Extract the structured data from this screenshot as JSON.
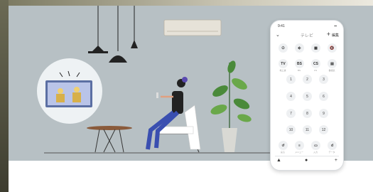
{
  "phone": {
    "status_time": "9:41",
    "status_right": "▪▪",
    "header_back": "⌄",
    "header_title": "テレビ",
    "header_add": "+",
    "header_edit": "編集",
    "row1": [
      {
        "icon": "power-icon",
        "glyph": "⏻",
        "label": ""
      },
      {
        "icon": "input-icon",
        "glyph": "⎆",
        "label": ""
      },
      {
        "icon": "grid-icon",
        "glyph": "▦",
        "label": ""
      },
      {
        "icon": "volume-mute-icon",
        "glyph": "🔇",
        "label": ""
      }
    ],
    "row2": [
      {
        "text": "TV",
        "label": "地上波"
      },
      {
        "text": "BS",
        "label": "BS"
      },
      {
        "text": "CS",
        "label": "CS"
      },
      {
        "text": "▤",
        "label": "番組表"
      }
    ],
    "numbers": [
      "1",
      "2",
      "3",
      "4",
      "5",
      "6",
      "7",
      "8",
      "9",
      "10",
      "11",
      "12"
    ],
    "row_bottom": [
      {
        "glyph": "↺",
        "label": "戻る"
      },
      {
        "glyph": "≡",
        "label": "メニュー"
      },
      {
        "glyph": "▭",
        "label": "入力"
      },
      {
        "glyph": "d",
        "label": "データ"
      }
    ],
    "bottom_bar": {
      "left": "▲",
      "center": "●",
      "right": "+"
    }
  }
}
